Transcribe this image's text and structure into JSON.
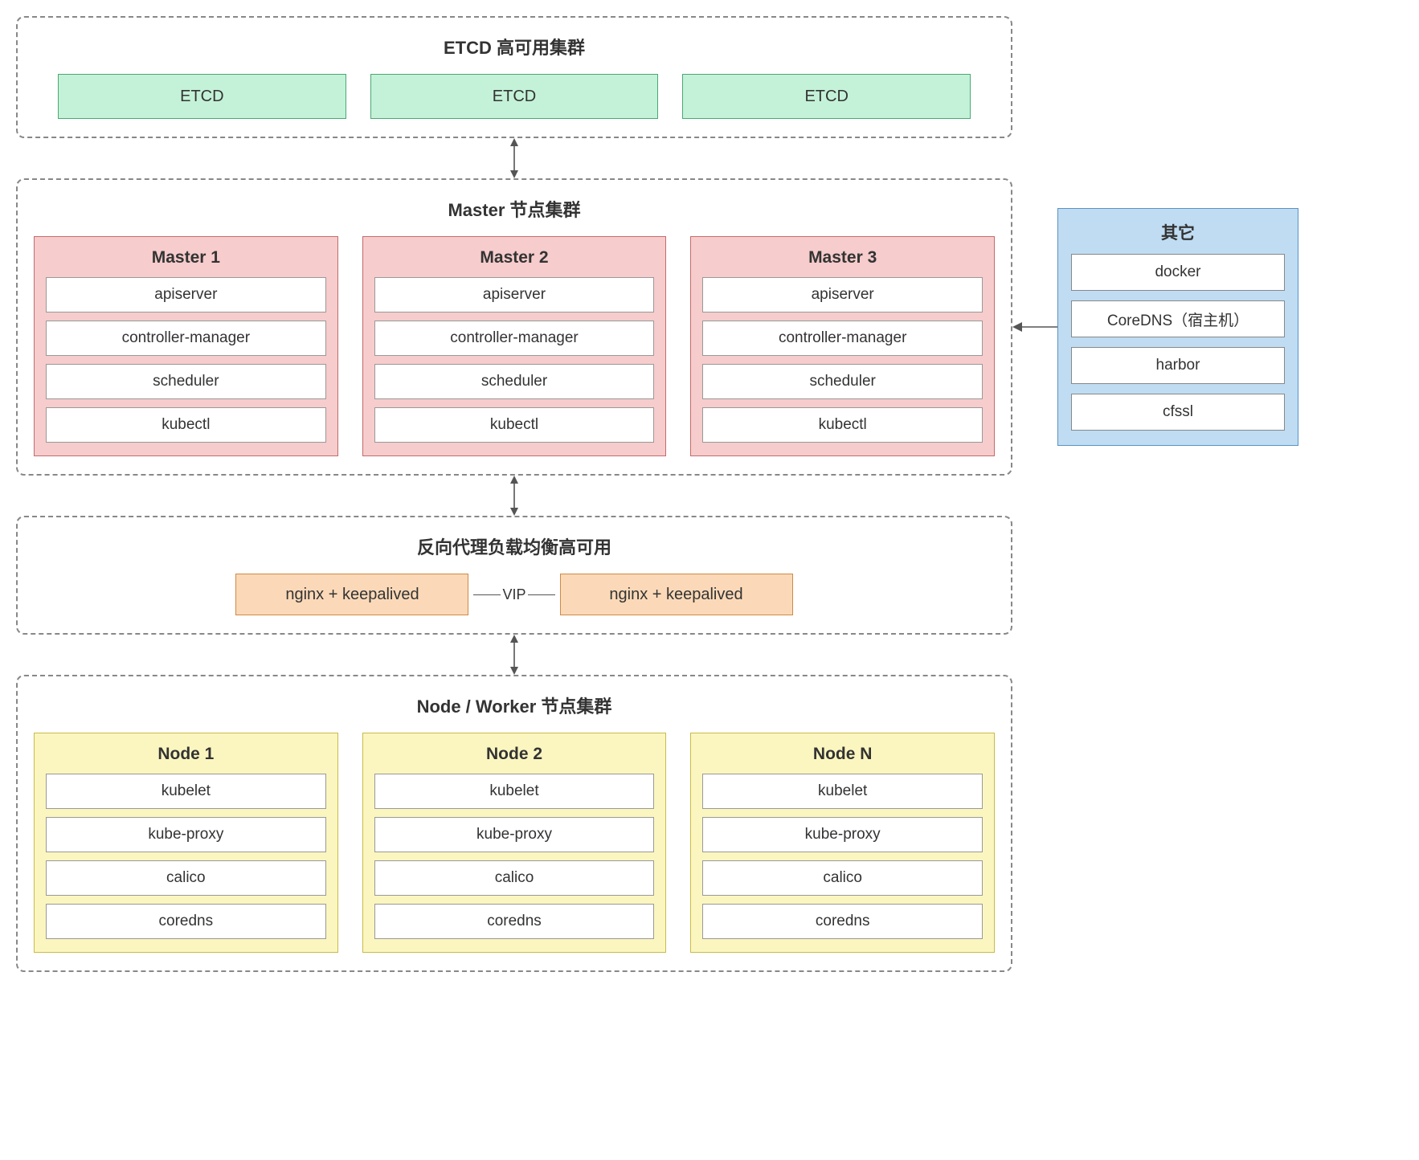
{
  "etcd_cluster": {
    "title": "ETCD 高可用集群",
    "nodes": [
      "ETCD",
      "ETCD",
      "ETCD"
    ]
  },
  "master_cluster": {
    "title": "Master 节点集群",
    "masters": [
      {
        "name": "Master 1",
        "components": [
          "apiserver",
          "controller-manager",
          "scheduler",
          "kubectl"
        ]
      },
      {
        "name": "Master 2",
        "components": [
          "apiserver",
          "controller-manager",
          "scheduler",
          "kubectl"
        ]
      },
      {
        "name": "Master 3",
        "components": [
          "apiserver",
          "controller-manager",
          "scheduler",
          "kubectl"
        ]
      }
    ]
  },
  "lb_cluster": {
    "title": "反向代理负载均衡高可用",
    "left": "nginx + keepalived",
    "vip_label": "VIP",
    "right": "nginx + keepalived"
  },
  "node_cluster": {
    "title": "Node / Worker 节点集群",
    "nodes": [
      {
        "name": "Node 1",
        "components": [
          "kubelet",
          "kube-proxy",
          "calico",
          "coredns"
        ]
      },
      {
        "name": "Node 2",
        "components": [
          "kubelet",
          "kube-proxy",
          "calico",
          "coredns"
        ]
      },
      {
        "name": "Node N",
        "components": [
          "kubelet",
          "kube-proxy",
          "calico",
          "coredns"
        ]
      }
    ]
  },
  "side": {
    "title": "其它",
    "items": [
      "docker",
      "CoreDNS（宿主机）",
      "harbor",
      "cfssl"
    ]
  }
}
